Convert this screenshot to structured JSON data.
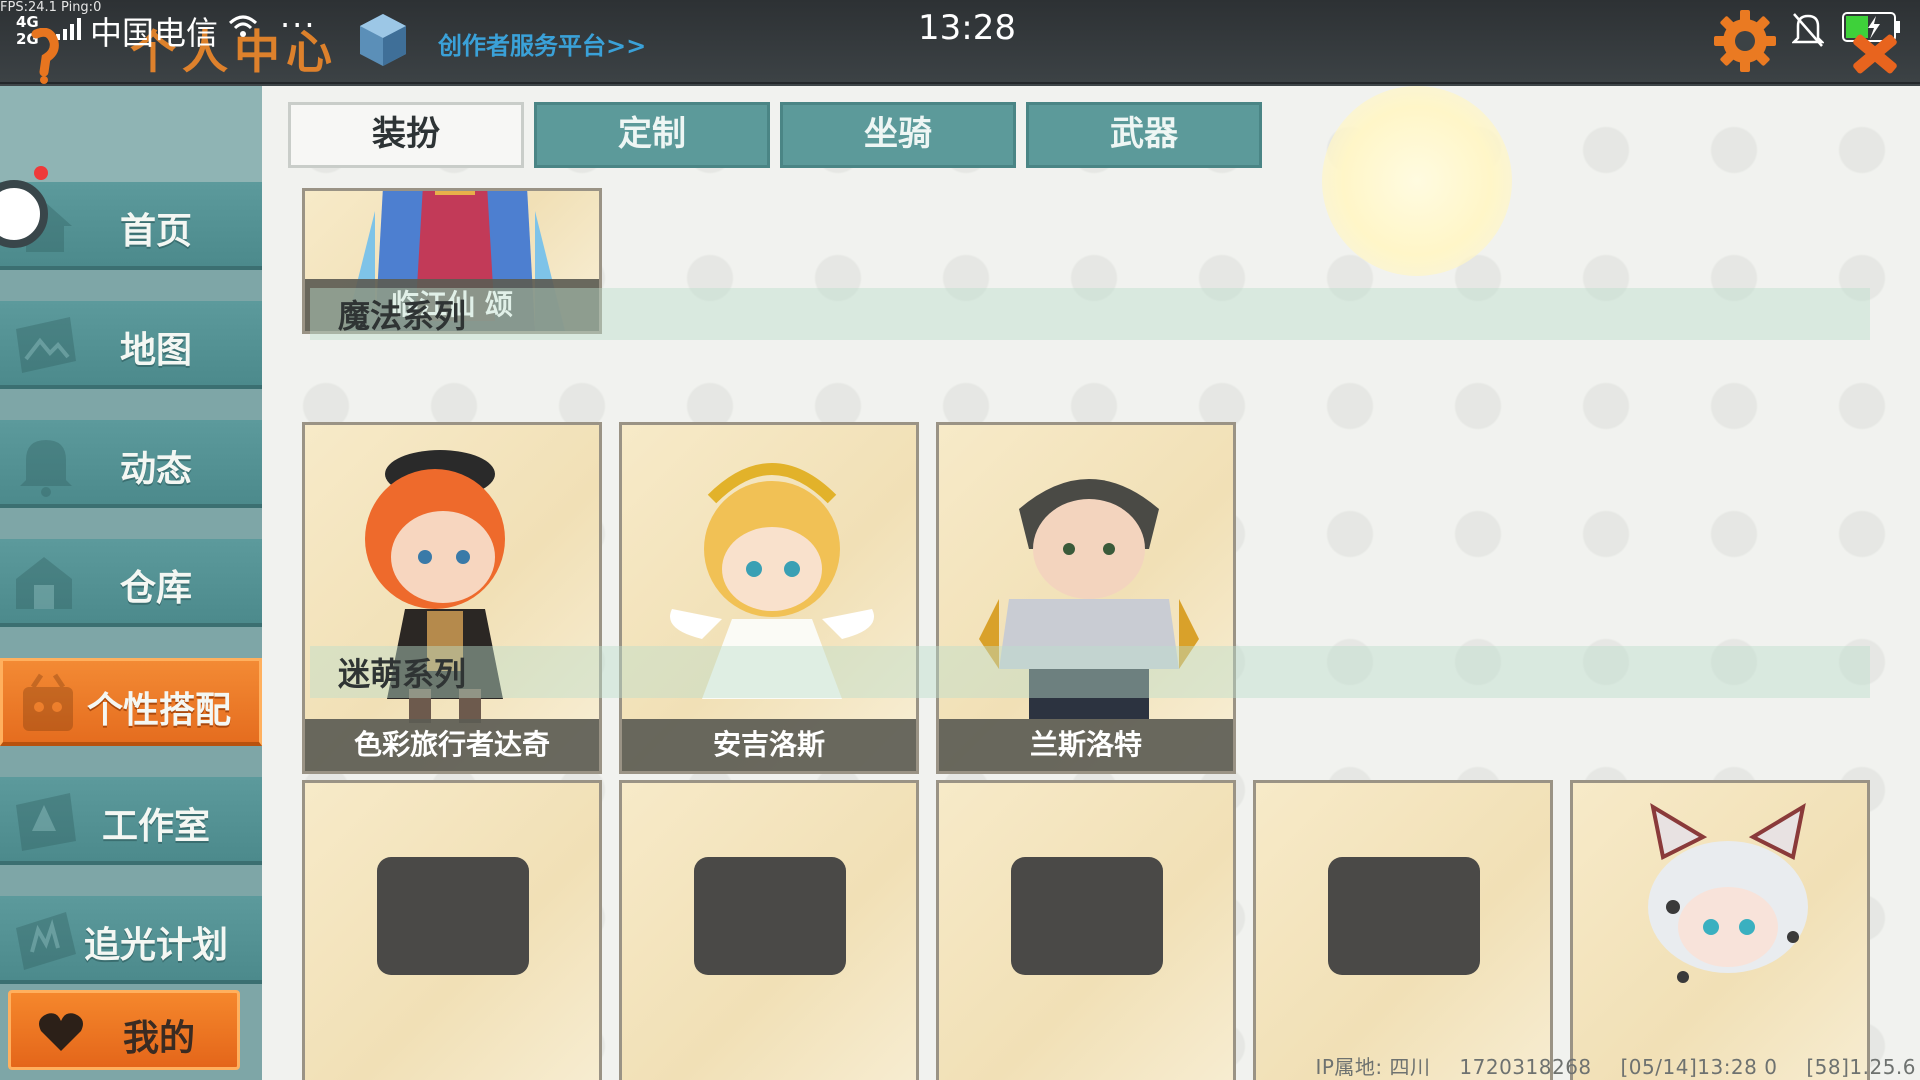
{
  "status_bar": {
    "fps": "FPS:24.1  Ping:0",
    "network": [
      "4G",
      "2G"
    ],
    "carrier": "中国电信",
    "more": "···",
    "time": "13:28"
  },
  "header": {
    "title": "个人中心",
    "creator_link": "创作者服务平台>>"
  },
  "sidebar": {
    "items": [
      {
        "label": "首页",
        "icon": "home-icon"
      },
      {
        "label": "地图",
        "icon": "map-icon"
      },
      {
        "label": "动态",
        "icon": "bell-icon"
      },
      {
        "label": "仓库",
        "icon": "warehouse-icon"
      },
      {
        "label": "个性搭配",
        "icon": "outfit-icon",
        "active": true
      },
      {
        "label": "工作室",
        "icon": "studio-icon"
      },
      {
        "label": "追光计划",
        "icon": "chase-light-icon"
      }
    ],
    "mine_label": "我的"
  },
  "tabs": [
    {
      "label": "装扮",
      "active": true
    },
    {
      "label": "定制"
    },
    {
      "label": "坐骑"
    },
    {
      "label": "武器"
    }
  ],
  "partial_card": {
    "label": "临江仙 颂"
  },
  "sections": [
    {
      "title": "魔法系列",
      "cards": [
        {
          "label": "色彩旅行者达奇"
        },
        {
          "label": "安吉洛斯"
        },
        {
          "label": "兰斯洛特"
        }
      ]
    },
    {
      "title": "迷萌系列",
      "cards": [
        {},
        {},
        {},
        {},
        {}
      ]
    }
  ],
  "footer": {
    "ip_location": "IP属地: 四川",
    "user_id": "1720318268",
    "timestamp": "[05/14]13:28 0",
    "version": "[58]1.25.6"
  },
  "colors": {
    "accent_orange": "#e8751f",
    "teal": "#5c9a9a",
    "creator_blue": "#3aa1d8"
  }
}
